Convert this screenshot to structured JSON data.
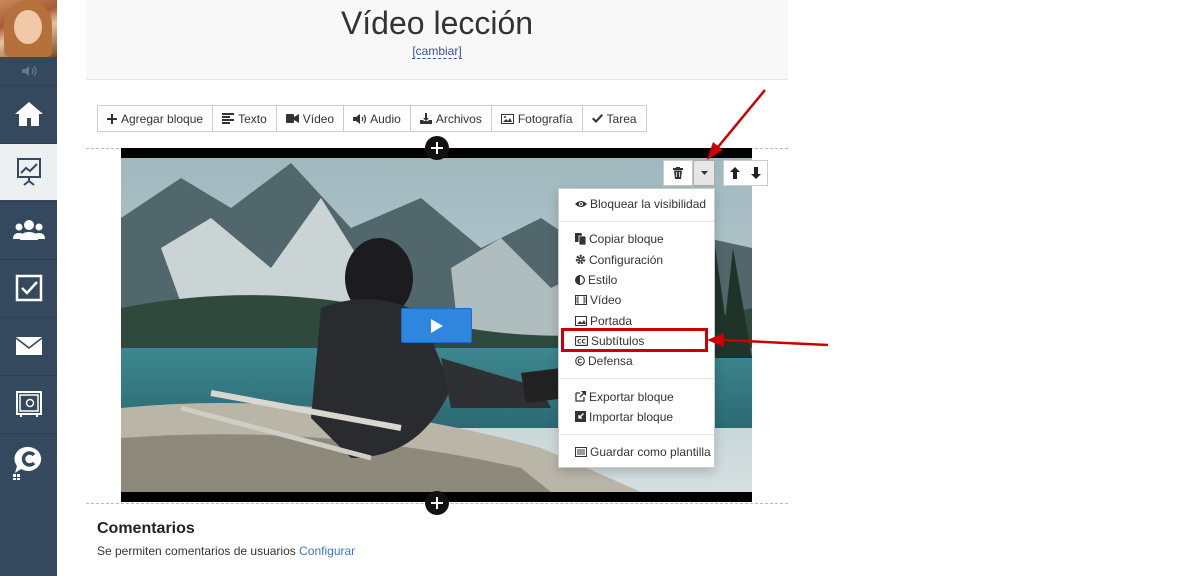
{
  "header": {
    "title": "Vídeo lección",
    "change_link": "[cambiar]"
  },
  "toolbar": {
    "buttons": [
      {
        "label": "Agregar bloque",
        "icon": "plus-icon"
      },
      {
        "label": "Texto",
        "icon": "align-left-icon"
      },
      {
        "label": "Vídeo",
        "icon": "video-camera-icon"
      },
      {
        "label": "Audio",
        "icon": "volume-icon"
      },
      {
        "label": "Archivos",
        "icon": "download-icon"
      },
      {
        "label": "Fotografía",
        "icon": "picture-icon"
      },
      {
        "label": "Tarea",
        "icon": "check-icon"
      }
    ]
  },
  "dropdown": {
    "items": [
      {
        "label": "Bloquear la visibilidad",
        "icon": "eye-icon"
      },
      {
        "label": "Copiar bloque",
        "icon": "copy-icon"
      },
      {
        "label": "Configuración",
        "icon": "gear-icon"
      },
      {
        "label": "Estilo",
        "icon": "contrast-icon"
      },
      {
        "label": "Vídeo",
        "icon": "film-icon"
      },
      {
        "label": "Portada",
        "icon": "picture-icon"
      },
      {
        "label": "Subtítulos",
        "icon": "cc-icon"
      },
      {
        "label": "Defensa",
        "icon": "copyright-icon"
      },
      {
        "label": "Exportar bloque",
        "icon": "external-link-icon"
      },
      {
        "label": "Importar bloque",
        "icon": "import-icon"
      },
      {
        "label": "Guardar como plantilla",
        "icon": "template-icon"
      }
    ]
  },
  "comments": {
    "title": "Comentarios",
    "text": "Se permiten comentarios de usuarios",
    "link": "Configurar"
  },
  "sidebar": {
    "items": [
      {
        "icon": "home-icon"
      },
      {
        "icon": "presentation-chart-icon",
        "active": true
      },
      {
        "icon": "users-icon"
      },
      {
        "icon": "checkbox-icon"
      },
      {
        "icon": "envelope-icon"
      },
      {
        "icon": "safe-icon"
      },
      {
        "icon": "chat-logo-icon"
      }
    ]
  },
  "colors": {
    "sidebar_bg": "#34495e",
    "play_button": "#2f86de",
    "highlight": "#cc0000",
    "link": "#3b7ac0"
  }
}
